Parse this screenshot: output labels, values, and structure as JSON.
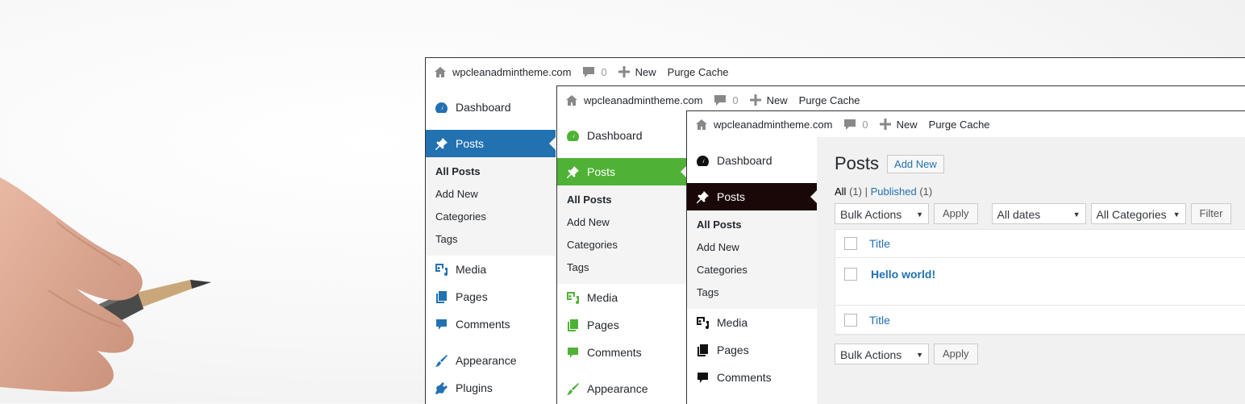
{
  "colors": {
    "blue": "#2271b1",
    "green": "#4fb236",
    "dark": "#1a0707"
  },
  "topbar": {
    "site": "wpcleanadmintheme.com",
    "comments": "0",
    "new": "New",
    "purge": "Purge Cache"
  },
  "menu": {
    "dashboard": "Dashboard",
    "posts": "Posts",
    "submenu": [
      "All Posts",
      "Add New",
      "Categories",
      "Tags"
    ],
    "media": "Media",
    "pages": "Pages",
    "comments": "Comments",
    "appearance": "Appearance",
    "plugins": "Plugins"
  },
  "posts_screen": {
    "title": "Posts",
    "add_new": "Add New",
    "filter_all": "All",
    "filter_all_count": "(1)",
    "separator": "|",
    "filter_published": "Published",
    "filter_published_count": "(1)",
    "bulk_actions": "Bulk Actions",
    "apply": "Apply",
    "all_dates": "All dates",
    "all_categories": "All Categories",
    "filter": "Filter",
    "column_title": "Title",
    "post": "Hello world!"
  }
}
